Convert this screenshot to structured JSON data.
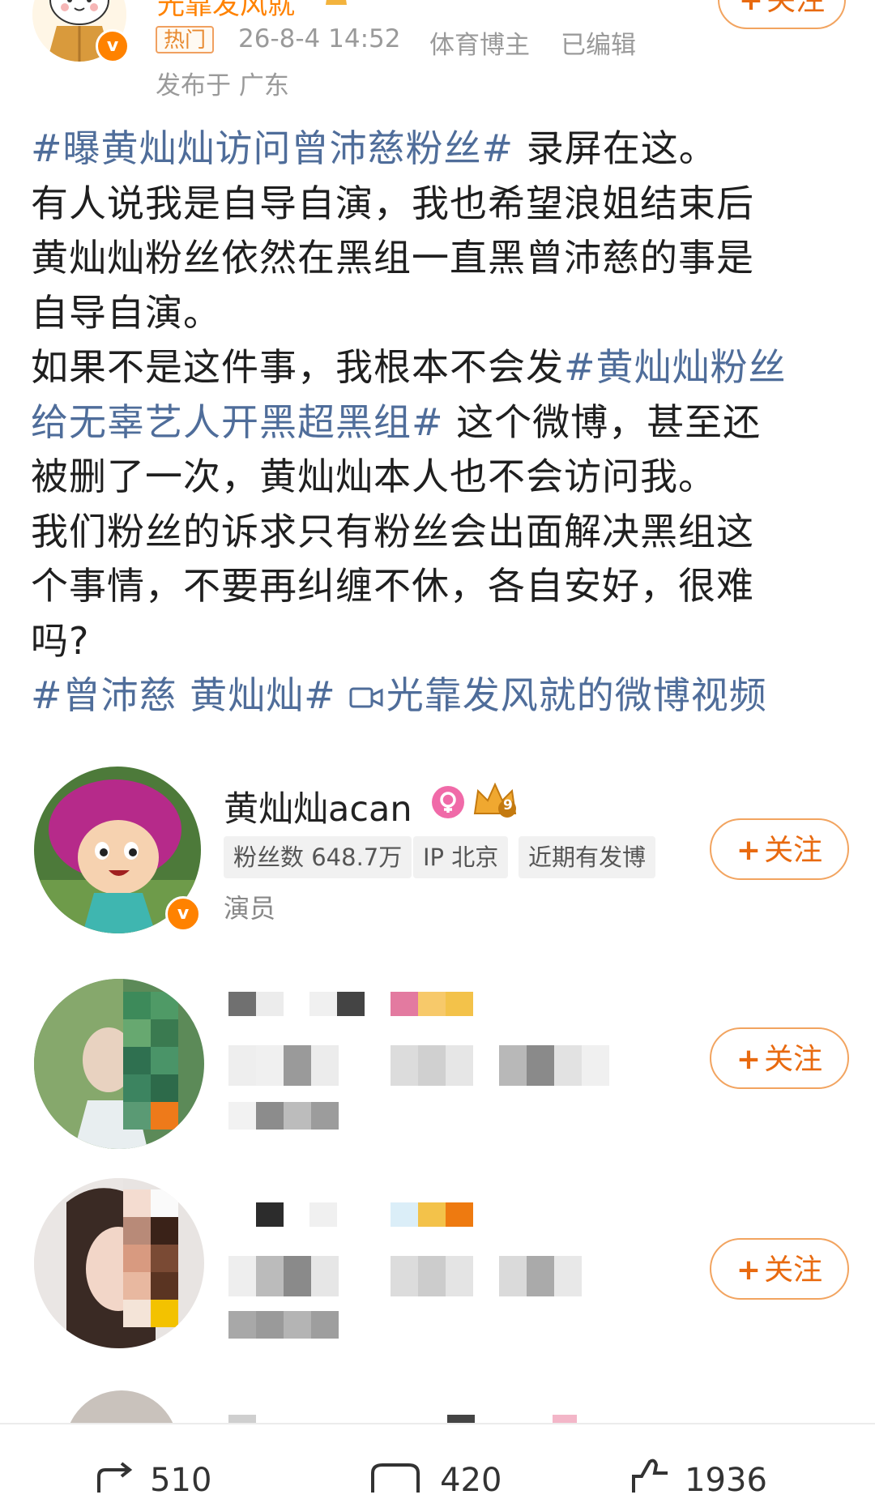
{
  "author": {
    "name": "光靠发风就",
    "follow_label": "关注",
    "hot_label": "热门",
    "date": "26-8-4 14:52",
    "category": "体育博主",
    "edited": "已编辑",
    "location": "发布于 广东",
    "verified_symbol": "v"
  },
  "post": {
    "line1_tag": "#曝黄灿灿访问曾沛慈粉丝#",
    "line1_rest": " 录屏在这。",
    "line2": "有人说我是自导自演，我也希望浪姐结束后",
    "line3": "黄灿灿粉丝依然在黑组一直黑曾沛慈的事是",
    "line4": "自导自演。",
    "line5_text": "如果不是这件事，我根本不会发",
    "line5_tag": "#黄灿灿粉丝",
    "line6_tag": "给无辜艺人开黑超黑组#",
    "line6_rest": " 这个微博，甚至还",
    "line7": "被删了一次，黄灿灿本人也不会访问我。",
    "line8": "我们粉丝的诉求只有粉丝会出面解决黑组这",
    "line9": "个事情，不要再纠缠不休，各自安好，很难",
    "line10": "吗?",
    "line11_tag": "#曾沛慈 黄灿灿#",
    "line11_video": "光靠发风就的微博视频"
  },
  "recommended_user": {
    "name": "黄灿灿acan",
    "fans_chip": "粉丝数 648.7万",
    "ip_chip": "IP 北京",
    "recent_chip": "近期有发博",
    "role": "演员",
    "follow_label": "关注",
    "crown_level": "9"
  },
  "other_users": [
    {
      "follow_label": "关注"
    },
    {
      "follow_label": "关注"
    }
  ],
  "bottom_bar": {
    "repost_count": "510",
    "comment_count": "420",
    "like_count": "1936"
  },
  "colors": {
    "accent": "#ff8200",
    "link": "#4f6d9a",
    "follow_border": "#f2a460"
  }
}
